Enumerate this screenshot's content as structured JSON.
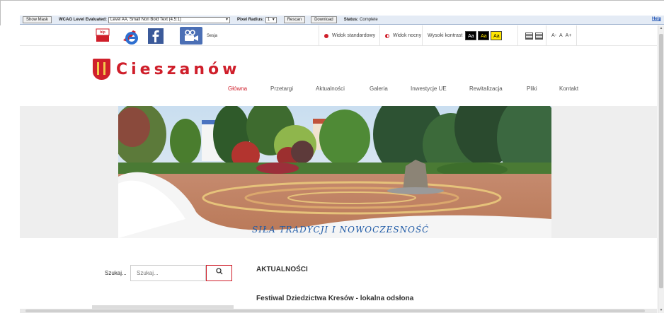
{
  "wcag_toolbar": {
    "show_mask": "Show Mask",
    "level_label": "WCAG Level Evaluated:",
    "level_value": "Level AA, Small Non Bold Text (4.5:1)",
    "pixel_radius_label": "Pixel Radius:",
    "pixel_radius_value": "1",
    "rescan": "Rescan",
    "download": "Download",
    "status_label": "Status:",
    "status_value": "Complete",
    "help": "Help"
  },
  "top_links": {
    "bip_label": "bip",
    "sesja_label": "Sesja"
  },
  "accessibility": {
    "standard_view": "Widok standardowy",
    "night_view": "Widok nocny",
    "high_contrast_label": "Wysoki kontrast",
    "contrast_options": [
      "Aa",
      "Aa",
      "Aa"
    ],
    "font_sizes": [
      "A-",
      "A",
      "A+"
    ]
  },
  "header": {
    "logo_text": "Cieszanów"
  },
  "nav": {
    "items": [
      "Główna",
      "Przetargi",
      "Aktualności",
      "Galeria",
      "Inwestycje UE",
      "Rewitalizacja",
      "Pliki",
      "Kontakt"
    ]
  },
  "banner": {
    "slogan": "SIŁA TRADYCJI I NOWOCZESNOŚĆ"
  },
  "search": {
    "label": "Szukaj...",
    "placeholder": "Szukaj..."
  },
  "news": {
    "heading": "AKTUALNOŚCI",
    "first_title": "Festiwal Dziedzictwa Kresów - lokalna odsłona"
  },
  "colors": {
    "brand_red": "#cf1e2a",
    "slogan_blue": "#1f5aa6",
    "contrast_yellow": "#ffe600"
  }
}
